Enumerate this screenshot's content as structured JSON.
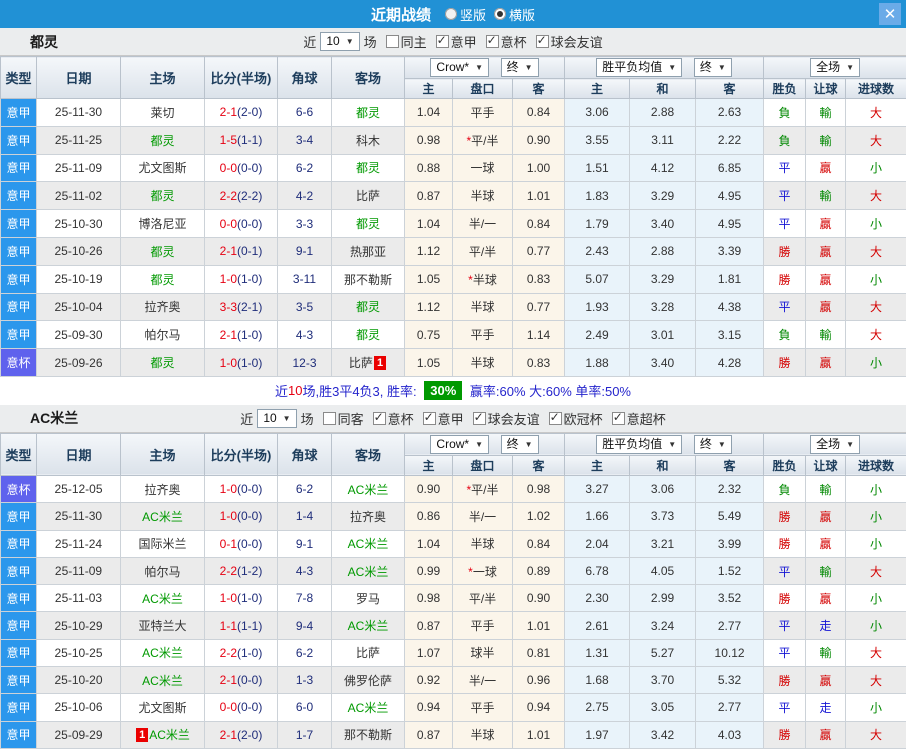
{
  "titlebar": {
    "title": "近期战绩",
    "view_options": [
      {
        "label": "竖版",
        "checked": false
      },
      {
        "label": "横版",
        "checked": true
      }
    ],
    "close": "✕"
  },
  "colors": {
    "titlebar_bg": "#2191d5",
    "close_btn_bg": "#6aabe8",
    "league_bg": "#2b97ec",
    "cup_bg": "#5f62ed",
    "team_green": "#009900",
    "score_red": "#e60012",
    "navy": "#1f2d7a",
    "win_red": "#d40000",
    "loss_green": "#008800",
    "draw_blue": "#1414d4",
    "summary_blue": "#2525cc",
    "badge_green": "#009900",
    "odds_bg": "#fbf5ea",
    "avg_bg": "#e9f3fa",
    "row_alt_bg": "#ebebeb"
  },
  "table_header": {
    "col_type": "类型",
    "col_date": "日期",
    "col_home": "主场",
    "col_score": "比分(半场)",
    "col_corner": "角球",
    "col_away": "客场",
    "dd_crow": "Crow*",
    "dd_final1": "终",
    "dd_avg": "胜平负均值",
    "dd_final2": "终",
    "dd_full": "全场",
    "sub_home": "主",
    "sub_handicap": "盘口",
    "sub_away": "客",
    "sub_avg_home": "主",
    "sub_avg_draw": "和",
    "sub_avg_away": "客",
    "col_result": "胜负",
    "col_let": "让球",
    "col_goals": "进球数"
  },
  "sections": [
    {
      "team": "都灵",
      "filter": {
        "near_label": "近",
        "count": "10",
        "games_label": "场",
        "options": [
          {
            "label": "同主",
            "checked": false
          },
          {
            "label": "意甲",
            "checked": true
          },
          {
            "label": "意杯",
            "checked": true
          },
          {
            "label": "球会友谊",
            "checked": true
          }
        ]
      },
      "rows": [
        {
          "type": "意甲",
          "cup": false,
          "date": "25-11-30",
          "home": "莱切",
          "home_team": false,
          "home_badge": "",
          "score_ft": "2-1",
          "score_ht": "(2-0)",
          "corner": "6-6",
          "away": "都灵",
          "away_team": true,
          "away_badge": "",
          "odds_home": "1.04",
          "handicap": "平手",
          "handicap_star": false,
          "odds_away": "0.84",
          "avg_home": "3.06",
          "avg_draw": "2.88",
          "avg_away": "2.63",
          "result": "負",
          "result_color": "g",
          "handicap_result": "輸",
          "handicap_result_color": "g",
          "goals": "大",
          "goals_color": "r"
        },
        {
          "type": "意甲",
          "cup": false,
          "date": "25-11-25",
          "home": "都灵",
          "home_team": true,
          "home_badge": "",
          "score_ft": "1-5",
          "score_ht": "(1-1)",
          "corner": "3-4",
          "away": "科木",
          "away_team": false,
          "away_badge": "",
          "odds_home": "0.98",
          "handicap": "平/半",
          "handicap_star": true,
          "odds_away": "0.90",
          "avg_home": "3.55",
          "avg_draw": "3.11",
          "avg_away": "2.22",
          "result": "負",
          "result_color": "g",
          "handicap_result": "輸",
          "handicap_result_color": "g",
          "goals": "大",
          "goals_color": "r"
        },
        {
          "type": "意甲",
          "cup": false,
          "date": "25-11-09",
          "home": "尤文图斯",
          "home_team": false,
          "home_badge": "",
          "score_ft": "0-0",
          "score_ht": "(0-0)",
          "corner": "6-2",
          "away": "都灵",
          "away_team": true,
          "away_badge": "",
          "odds_home": "0.88",
          "handicap": "一球",
          "handicap_star": false,
          "odds_away": "1.00",
          "avg_home": "1.51",
          "avg_draw": "4.12",
          "avg_away": "6.85",
          "result": "平",
          "result_color": "b",
          "handicap_result": "贏",
          "handicap_result_color": "r",
          "goals": "小",
          "goals_color": "g"
        },
        {
          "type": "意甲",
          "cup": false,
          "date": "25-11-02",
          "home": "都灵",
          "home_team": true,
          "home_badge": "",
          "score_ft": "2-2",
          "score_ht": "(2-2)",
          "corner": "4-2",
          "away": "比萨",
          "away_team": false,
          "away_badge": "",
          "odds_home": "0.87",
          "handicap": "半球",
          "handicap_star": false,
          "odds_away": "1.01",
          "avg_home": "1.83",
          "avg_draw": "3.29",
          "avg_away": "4.95",
          "result": "平",
          "result_color": "b",
          "handicap_result": "輸",
          "handicap_result_color": "g",
          "goals": "大",
          "goals_color": "r"
        },
        {
          "type": "意甲",
          "cup": false,
          "date": "25-10-30",
          "home": "博洛尼亚",
          "home_team": false,
          "home_badge": "",
          "score_ft": "0-0",
          "score_ht": "(0-0)",
          "corner": "3-3",
          "away": "都灵",
          "away_team": true,
          "away_badge": "",
          "odds_home": "1.04",
          "handicap": "半/一",
          "handicap_star": false,
          "odds_away": "0.84",
          "avg_home": "1.79",
          "avg_draw": "3.40",
          "avg_away": "4.95",
          "result": "平",
          "result_color": "b",
          "handicap_result": "贏",
          "handicap_result_color": "r",
          "goals": "小",
          "goals_color": "g"
        },
        {
          "type": "意甲",
          "cup": false,
          "date": "25-10-26",
          "home": "都灵",
          "home_team": true,
          "home_badge": "",
          "score_ft": "2-1",
          "score_ht": "(0-1)",
          "corner": "9-1",
          "away": "热那亚",
          "away_team": false,
          "away_badge": "",
          "odds_home": "1.12",
          "handicap": "平/半",
          "handicap_star": false,
          "odds_away": "0.77",
          "avg_home": "2.43",
          "avg_draw": "2.88",
          "avg_away": "3.39",
          "result": "勝",
          "result_color": "r",
          "handicap_result": "贏",
          "handicap_result_color": "r",
          "goals": "大",
          "goals_color": "r"
        },
        {
          "type": "意甲",
          "cup": false,
          "date": "25-10-19",
          "home": "都灵",
          "home_team": true,
          "home_badge": "",
          "score_ft": "1-0",
          "score_ht": "(1-0)",
          "corner": "3-11",
          "away": "那不勒斯",
          "away_team": false,
          "away_badge": "",
          "odds_home": "1.05",
          "handicap": "半球",
          "handicap_star": true,
          "odds_away": "0.83",
          "avg_home": "5.07",
          "avg_draw": "3.29",
          "avg_away": "1.81",
          "result": "勝",
          "result_color": "r",
          "handicap_result": "贏",
          "handicap_result_color": "r",
          "goals": "小",
          "goals_color": "g"
        },
        {
          "type": "意甲",
          "cup": false,
          "date": "25-10-04",
          "home": "拉齐奥",
          "home_team": false,
          "home_badge": "",
          "score_ft": "3-3",
          "score_ht": "(2-1)",
          "corner": "3-5",
          "away": "都灵",
          "away_team": true,
          "away_badge": "",
          "odds_home": "1.12",
          "handicap": "半球",
          "handicap_star": false,
          "odds_away": "0.77",
          "avg_home": "1.93",
          "avg_draw": "3.28",
          "avg_away": "4.38",
          "result": "平",
          "result_color": "b",
          "handicap_result": "贏",
          "handicap_result_color": "r",
          "goals": "大",
          "goals_color": "r"
        },
        {
          "type": "意甲",
          "cup": false,
          "date": "25-09-30",
          "home": "帕尔马",
          "home_team": false,
          "home_badge": "",
          "score_ft": "2-1",
          "score_ht": "(1-0)",
          "corner": "4-3",
          "away": "都灵",
          "away_team": true,
          "away_badge": "",
          "odds_home": "0.75",
          "handicap": "平手",
          "handicap_star": false,
          "odds_away": "1.14",
          "avg_home": "2.49",
          "avg_draw": "3.01",
          "avg_away": "3.15",
          "result": "負",
          "result_color": "g",
          "handicap_result": "輸",
          "handicap_result_color": "g",
          "goals": "大",
          "goals_color": "r"
        },
        {
          "type": "意杯",
          "cup": true,
          "date": "25-09-26",
          "home": "都灵",
          "home_team": true,
          "home_badge": "",
          "score_ft": "1-0",
          "score_ht": "(1-0)",
          "corner": "12-3",
          "away": "比萨",
          "away_team": false,
          "away_badge": "1",
          "odds_home": "1.05",
          "handicap": "半球",
          "handicap_star": false,
          "odds_away": "0.83",
          "avg_home": "1.88",
          "avg_draw": "3.40",
          "avg_away": "4.28",
          "result": "勝",
          "result_color": "r",
          "handicap_result": "贏",
          "handicap_result_color": "r",
          "goals": "小",
          "goals_color": "g"
        }
      ],
      "summary": {
        "text_near": "近",
        "games_count": "10",
        "text_record": "场,胜3平4负3, 胜率: ",
        "win_rate_badge": "30%",
        "rest_text": " 赢率:60% 大:60% 单率:50%"
      }
    },
    {
      "team": "AC米兰",
      "filter": {
        "near_label": "近",
        "count": "10",
        "games_label": "场",
        "options": [
          {
            "label": "同客",
            "checked": false
          },
          {
            "label": "意杯",
            "checked": true
          },
          {
            "label": "意甲",
            "checked": true
          },
          {
            "label": "球会友谊",
            "checked": true
          },
          {
            "label": "欧冠杯",
            "checked": true
          },
          {
            "label": "意超杯",
            "checked": true
          }
        ]
      },
      "rows": [
        {
          "type": "意杯",
          "cup": true,
          "date": "25-12-05",
          "home": "拉齐奥",
          "home_team": false,
          "home_badge": "",
          "score_ft": "1-0",
          "score_ht": "(0-0)",
          "corner": "6-2",
          "away": "AC米兰",
          "away_team": true,
          "away_badge": "",
          "odds_home": "0.90",
          "handicap": "平/半",
          "handicap_star": true,
          "odds_away": "0.98",
          "avg_home": "3.27",
          "avg_draw": "3.06",
          "avg_away": "2.32",
          "result": "負",
          "result_color": "g",
          "handicap_result": "輸",
          "handicap_result_color": "g",
          "goals": "小",
          "goals_color": "g"
        },
        {
          "type": "意甲",
          "cup": false,
          "date": "25-11-30",
          "home": "AC米兰",
          "home_team": true,
          "home_badge": "",
          "score_ft": "1-0",
          "score_ht": "(0-0)",
          "corner": "1-4",
          "away": "拉齐奥",
          "away_team": false,
          "away_badge": "",
          "odds_home": "0.86",
          "handicap": "半/一",
          "handicap_star": false,
          "odds_away": "1.02",
          "avg_home": "1.66",
          "avg_draw": "3.73",
          "avg_away": "5.49",
          "result": "勝",
          "result_color": "r",
          "handicap_result": "贏",
          "handicap_result_color": "r",
          "goals": "小",
          "goals_color": "g"
        },
        {
          "type": "意甲",
          "cup": false,
          "date": "25-11-24",
          "home": "国际米兰",
          "home_team": false,
          "home_badge": "",
          "score_ft": "0-1",
          "score_ht": "(0-0)",
          "corner": "9-1",
          "away": "AC米兰",
          "away_team": true,
          "away_badge": "",
          "odds_home": "1.04",
          "handicap": "半球",
          "handicap_star": false,
          "odds_away": "0.84",
          "avg_home": "2.04",
          "avg_draw": "3.21",
          "avg_away": "3.99",
          "result": "勝",
          "result_color": "r",
          "handicap_result": "贏",
          "handicap_result_color": "r",
          "goals": "小",
          "goals_color": "g"
        },
        {
          "type": "意甲",
          "cup": false,
          "date": "25-11-09",
          "home": "帕尔马",
          "home_team": false,
          "home_badge": "",
          "score_ft": "2-2",
          "score_ht": "(1-2)",
          "corner": "4-3",
          "away": "AC米兰",
          "away_team": true,
          "away_badge": "",
          "odds_home": "0.99",
          "handicap": "一球",
          "handicap_star": true,
          "odds_away": "0.89",
          "avg_home": "6.78",
          "avg_draw": "4.05",
          "avg_away": "1.52",
          "result": "平",
          "result_color": "b",
          "handicap_result": "輸",
          "handicap_result_color": "g",
          "goals": "大",
          "goals_color": "r"
        },
        {
          "type": "意甲",
          "cup": false,
          "date": "25-11-03",
          "home": "AC米兰",
          "home_team": true,
          "home_badge": "",
          "score_ft": "1-0",
          "score_ht": "(1-0)",
          "corner": "7-8",
          "away": "罗马",
          "away_team": false,
          "away_badge": "",
          "odds_home": "0.98",
          "handicap": "平/半",
          "handicap_star": false,
          "odds_away": "0.90",
          "avg_home": "2.30",
          "avg_draw": "2.99",
          "avg_away": "3.52",
          "result": "勝",
          "result_color": "r",
          "handicap_result": "贏",
          "handicap_result_color": "r",
          "goals": "小",
          "goals_color": "g"
        },
        {
          "type": "意甲",
          "cup": false,
          "date": "25-10-29",
          "home": "亚特兰大",
          "home_team": false,
          "home_badge": "",
          "score_ft": "1-1",
          "score_ht": "(1-1)",
          "corner": "9-4",
          "away": "AC米兰",
          "away_team": true,
          "away_badge": "",
          "odds_home": "0.87",
          "handicap": "平手",
          "handicap_star": false,
          "odds_away": "1.01",
          "avg_home": "2.61",
          "avg_draw": "3.24",
          "avg_away": "2.77",
          "result": "平",
          "result_color": "b",
          "handicap_result": "走",
          "handicap_result_color": "b",
          "goals": "小",
          "goals_color": "g"
        },
        {
          "type": "意甲",
          "cup": false,
          "date": "25-10-25",
          "home": "AC米兰",
          "home_team": true,
          "home_badge": "",
          "score_ft": "2-2",
          "score_ht": "(1-0)",
          "corner": "6-2",
          "away": "比萨",
          "away_team": false,
          "away_badge": "",
          "odds_home": "1.07",
          "handicap": "球半",
          "handicap_star": false,
          "odds_away": "0.81",
          "avg_home": "1.31",
          "avg_draw": "5.27",
          "avg_away": "10.12",
          "result": "平",
          "result_color": "b",
          "handicap_result": "輸",
          "handicap_result_color": "g",
          "goals": "大",
          "goals_color": "r"
        },
        {
          "type": "意甲",
          "cup": false,
          "date": "25-10-20",
          "home": "AC米兰",
          "home_team": true,
          "home_badge": "",
          "score_ft": "2-1",
          "score_ht": "(0-0)",
          "corner": "1-3",
          "away": "佛罗伦萨",
          "away_team": false,
          "away_badge": "",
          "odds_home": "0.92",
          "handicap": "半/一",
          "handicap_star": false,
          "odds_away": "0.96",
          "avg_home": "1.68",
          "avg_draw": "3.70",
          "avg_away": "5.32",
          "result": "勝",
          "result_color": "r",
          "handicap_result": "贏",
          "handicap_result_color": "r",
          "goals": "大",
          "goals_color": "r"
        },
        {
          "type": "意甲",
          "cup": false,
          "date": "25-10-06",
          "home": "尤文图斯",
          "home_team": false,
          "home_badge": "",
          "score_ft": "0-0",
          "score_ht": "(0-0)",
          "corner": "6-0",
          "away": "AC米兰",
          "away_team": true,
          "away_badge": "",
          "odds_home": "0.94",
          "handicap": "平手",
          "handicap_star": false,
          "odds_away": "0.94",
          "avg_home": "2.75",
          "avg_draw": "3.05",
          "avg_away": "2.77",
          "result": "平",
          "result_color": "b",
          "handicap_result": "走",
          "handicap_result_color": "b",
          "goals": "小",
          "goals_color": "g"
        },
        {
          "type": "意甲",
          "cup": false,
          "date": "25-09-29",
          "home": "AC米兰",
          "home_team": true,
          "home_badge": "1",
          "score_ft": "2-1",
          "score_ht": "(2-0)",
          "corner": "1-7",
          "away": "那不勒斯",
          "away_team": false,
          "away_badge": "",
          "odds_home": "0.87",
          "handicap": "半球",
          "handicap_star": false,
          "odds_away": "1.01",
          "avg_home": "1.97",
          "avg_draw": "3.42",
          "avg_away": "4.03",
          "result": "勝",
          "result_color": "r",
          "handicap_result": "贏",
          "handicap_result_color": "r",
          "goals": "大",
          "goals_color": "r"
        }
      ]
    }
  ]
}
